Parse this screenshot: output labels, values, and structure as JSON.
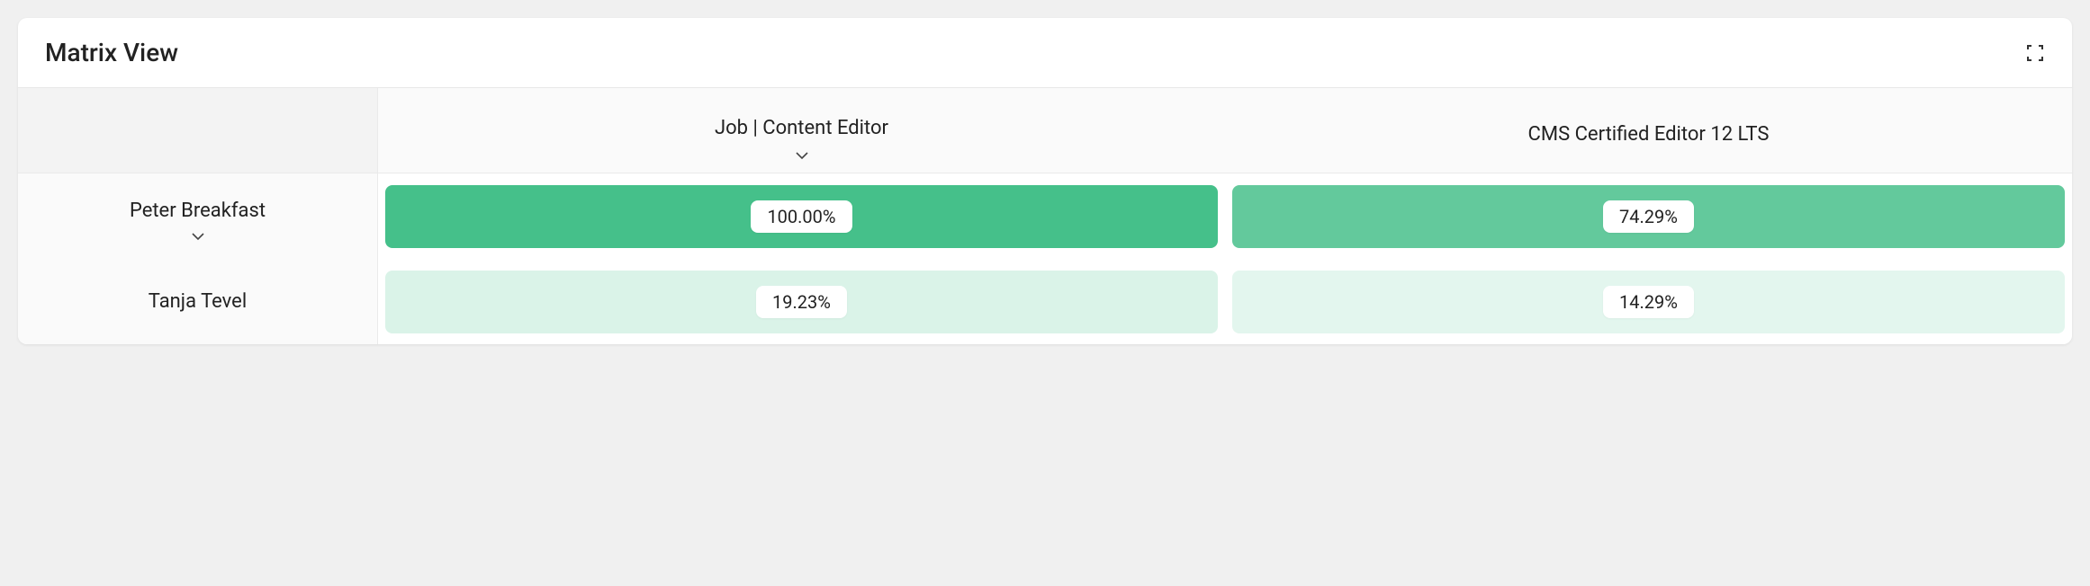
{
  "header": {
    "title": "Matrix View"
  },
  "columns": [
    {
      "label": "Job | Content Editor",
      "expandable": true
    },
    {
      "label": "CMS Certified Editor 12 LTS",
      "expandable": false
    }
  ],
  "rows": [
    {
      "label": "Peter Breakfast",
      "expandable": true,
      "cells": [
        {
          "value": "100.00%",
          "color": "#45c08a"
        },
        {
          "value": "74.29%",
          "color": "#63c99c"
        }
      ]
    },
    {
      "label": "Tanja Tevel",
      "expandable": false,
      "cells": [
        {
          "value": "19.23%",
          "color": "#daf3e8"
        },
        {
          "value": "14.29%",
          "color": "#e3f6ee"
        }
      ]
    }
  ],
  "chart_data": {
    "type": "heatmap",
    "title": "Matrix View",
    "row_labels": [
      "Peter Breakfast",
      "Tanja Tevel"
    ],
    "col_labels": [
      "Job | Content Editor",
      "CMS Certified Editor 12 LTS"
    ],
    "values": [
      [
        100.0,
        74.29
      ],
      [
        19.23,
        14.29
      ]
    ],
    "unit": "%",
    "value_range": [
      0,
      100
    ]
  }
}
